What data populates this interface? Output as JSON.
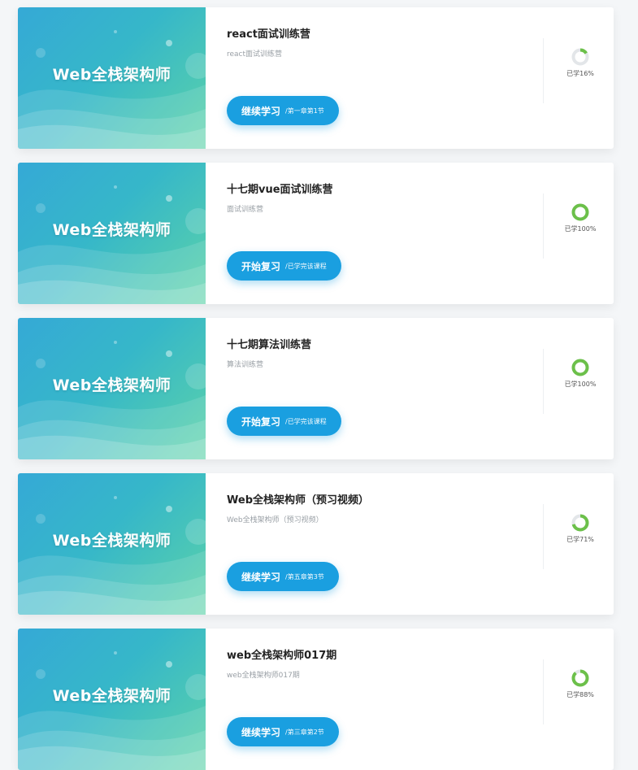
{
  "thumbnail_text": "Web全栈架构师",
  "courses": [
    {
      "title": "react面试训练营",
      "subtitle": "react面试训练营",
      "button_label": "继续学习",
      "button_sub": "/第一章第1节",
      "progress_label": "已学16%",
      "progress": 0.16
    },
    {
      "title": "十七期vue面试训练营",
      "subtitle": "面试训练营",
      "button_label": "开始复习",
      "button_sub": "/已学完该课程",
      "progress_label": "已学100%",
      "progress": 1.0
    },
    {
      "title": "十七期算法训练营",
      "subtitle": "算法训练营",
      "button_label": "开始复习",
      "button_sub": "/已学完该课程",
      "progress_label": "已学100%",
      "progress": 1.0
    },
    {
      "title": "Web全栈架构师（预习视频）",
      "subtitle": "Web全栈架构师（预习视频）",
      "button_label": "继续学习",
      "button_sub": "/第五章第3节",
      "progress_label": "已学71%",
      "progress": 0.71
    },
    {
      "title": "web全栈架构师017期",
      "subtitle": "web全栈架构师017期",
      "button_label": "继续学习",
      "button_sub": "/第三章第2节",
      "progress_label": "已学88%",
      "progress": 0.88
    }
  ],
  "colors": {
    "accent": "#1a9fe0",
    "progress": "#6cc04a",
    "track": "#e3e6e9"
  }
}
